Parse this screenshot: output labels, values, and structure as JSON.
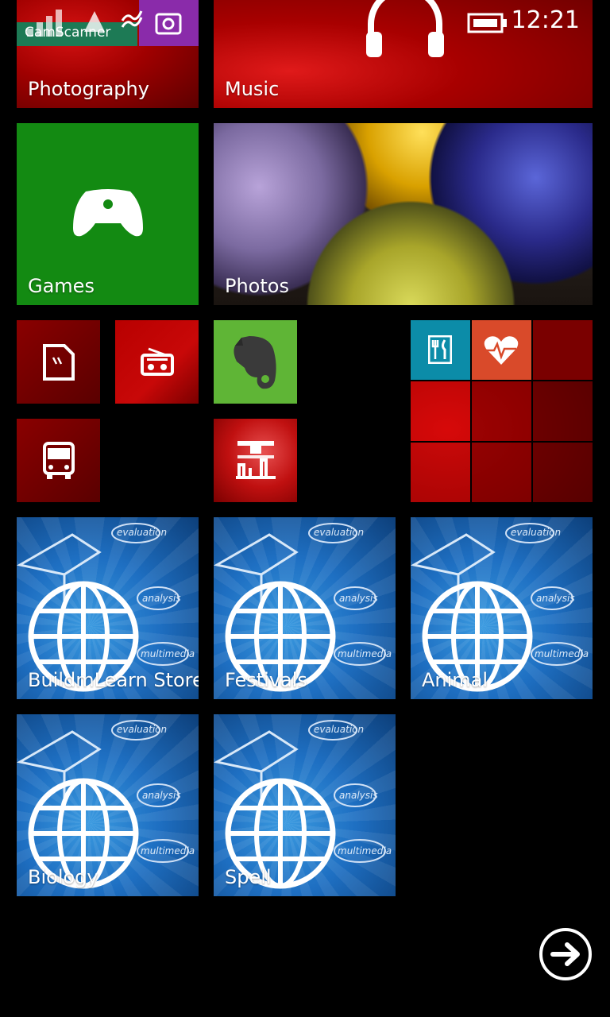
{
  "status_bar": {
    "time": "12:21",
    "notification_app": "CamScanner"
  },
  "tiles": {
    "photography": {
      "label": "Photography"
    },
    "music": {
      "label": "Music"
    },
    "games": {
      "label": "Games"
    },
    "photos": {
      "label": "Photos"
    },
    "buildmlearn_store": {
      "label": "BuildmLearn Store"
    },
    "festivals": {
      "label": "Festivals"
    },
    "animal": {
      "label": "Animal"
    },
    "biology": {
      "label": "Biology"
    },
    "spell": {
      "label": "Spell"
    }
  },
  "globe_tile_words": {
    "w1": "evaluation",
    "w2": "analysis",
    "w3": "multimedia"
  },
  "colors": {
    "games_green": "#138A12",
    "evernote_green": "#5FB536",
    "food_teal": "#0C8CA8",
    "health_orange": "#D94A2A",
    "camscanner_green": "#1D7A55",
    "notification_purple": "#8A2BAA"
  },
  "icons": {
    "games": "xbox-controller-icon",
    "music": "headphones-icon",
    "document": "document-icon",
    "radio": "radio-icon",
    "transit": "bus-icon",
    "evernote": "evernote-elephant-icon",
    "food": "fork-knife-icon",
    "health": "heart-pulse-icon",
    "arrow": "arrow-right-circle-icon"
  }
}
